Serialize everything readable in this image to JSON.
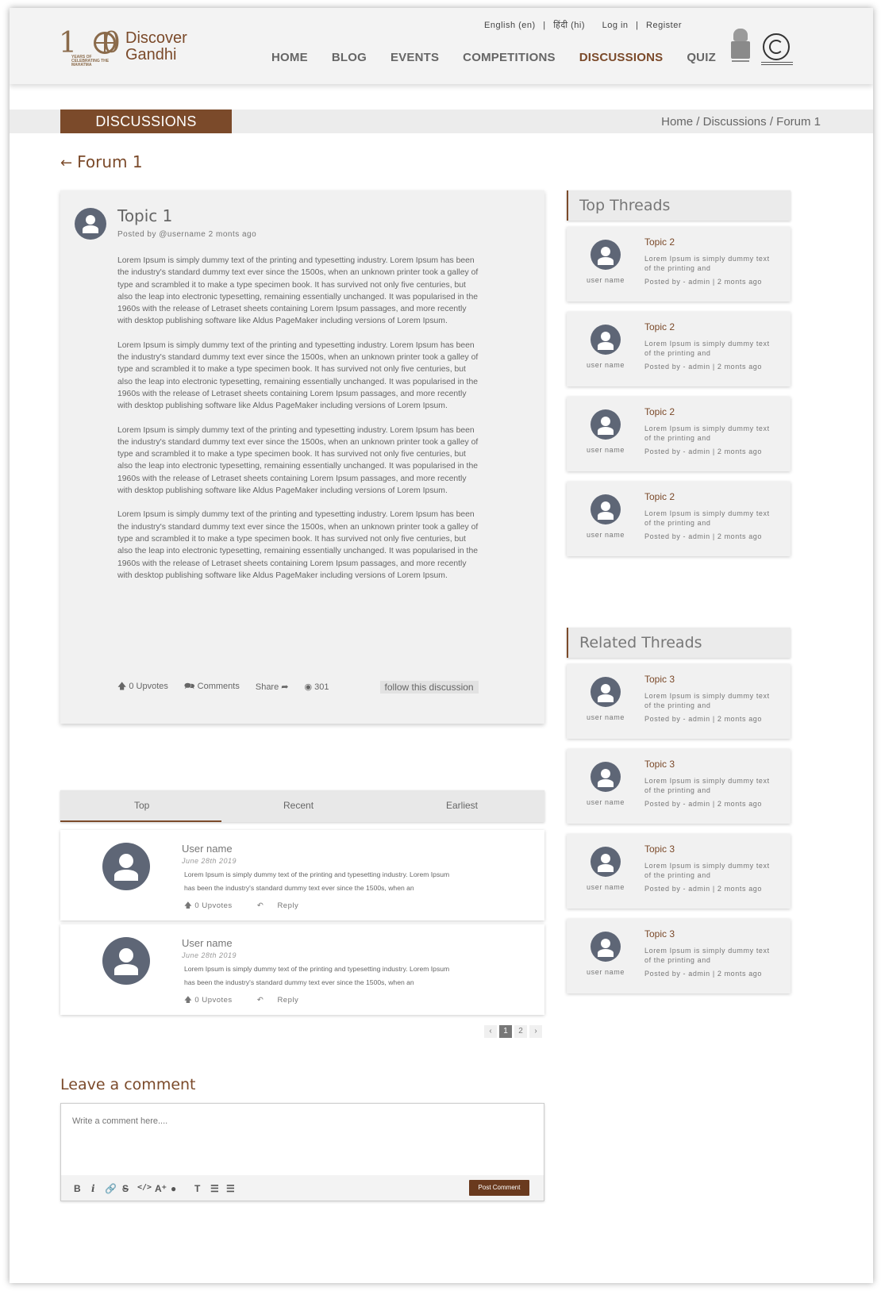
{
  "header": {
    "logo_number": "150",
    "logo_tagline": "YEARS OF CELEBRATING THE MAHATMA",
    "logo_title": "Discover Gandhi",
    "top_links": [
      "English (en)",
      "|",
      "हिंदी (hi)",
      "Log in",
      "|",
      "Register"
    ],
    "nav": [
      "HOME",
      "BLOG",
      "EVENTS",
      "COMPETITIONS",
      "DISCUSSIONS",
      "QUIZ"
    ],
    "active_nav": "DISCUSSIONS"
  },
  "banner": {
    "title": "DISCUSSIONS",
    "breadcrumb": "Home / Discussions / Forum 1"
  },
  "forum": {
    "back_arrow": "←",
    "title": "Forum 1"
  },
  "post": {
    "title": "Topic 1",
    "meta": "Posted by @username  2 monts ago",
    "paragraph": "Lorem Ipsum is simply dummy text of the printing and typesetting industry. Lorem Ipsum has been the industry's standard dummy text ever since the 1500s, when an unknown printer took a galley of type and scrambled it to make a type specimen book. It has survived not only five centuries, but also the leap into electronic typesetting, remaining essentially unchanged. It was popularised in the 1960s with the release of Letraset sheets containing Lorem Ipsum passages, and more recently with desktop publishing software like Aldus PageMaker including versions of Lorem Ipsum.",
    "upvotes": "0 Upvotes",
    "comments": "Comments",
    "share": "Share",
    "views": "301",
    "follow": "follow this discussion"
  },
  "tabs": [
    "Top",
    "Recent",
    "Earliest"
  ],
  "comments": [
    {
      "name": "User name",
      "date": "June 28th 2019",
      "text": "Lorem Ipsum is simply dummy text of the printing and typesetting industry. Lorem Ipsum has been the industry's standard dummy text ever since the 1500s, when an",
      "upvotes": "0 Upvotes",
      "reply": "Reply"
    },
    {
      "name": "User name",
      "date": "June 28th 2019",
      "text": "Lorem Ipsum is simply dummy text of the printing and typesetting industry. Lorem Ipsum has been the industry's standard dummy text ever since the 1500s, when an",
      "upvotes": "0 Upvotes",
      "reply": "Reply"
    }
  ],
  "pagination": {
    "prev": "‹",
    "pages": [
      "1",
      "2"
    ],
    "current": "1",
    "next": "›"
  },
  "leave_comment": {
    "title": "Leave a comment",
    "placeholder": "Write a comment here....",
    "submit": "Post Comment"
  },
  "top_threads": {
    "title": "Top Threads",
    "items": [
      {
        "user": "user name",
        "title": "Topic 2",
        "desc": "Lorem Ipsum is simply dummy text of the printing and",
        "posted": "Posted by - admin | 2 monts ago"
      },
      {
        "user": "user name",
        "title": "Topic 2",
        "desc": "Lorem Ipsum is simply dummy text of the printing and",
        "posted": "Posted by - admin | 2 monts ago"
      },
      {
        "user": "user name",
        "title": "Topic 2",
        "desc": "Lorem Ipsum is simply dummy text of the printing and",
        "posted": "Posted by - admin | 2 monts ago"
      },
      {
        "user": "user name",
        "title": "Topic 2",
        "desc": "Lorem Ipsum is simply dummy text of the printing and",
        "posted": "Posted by - admin | 2 monts ago"
      }
    ]
  },
  "related_threads": {
    "title": "Related Threads",
    "items": [
      {
        "user": "user name",
        "title": "Topic 3",
        "desc": "Lorem Ipsum is simply dummy text of the printing and",
        "posted": "Posted by - admin | 2 monts ago"
      },
      {
        "user": "user name",
        "title": "Topic 3",
        "desc": "Lorem Ipsum is simply dummy text of the printing and",
        "posted": "Posted by - admin | 2 monts ago"
      },
      {
        "user": "user name",
        "title": "Topic 3",
        "desc": "Lorem Ipsum is simply dummy text of the printing and",
        "posted": "Posted by - admin | 2 monts ago"
      },
      {
        "user": "user name",
        "title": "Topic 3",
        "desc": "Lorem Ipsum is simply dummy text of the printing and",
        "posted": "Posted by - admin | 2 monts ago"
      }
    ]
  },
  "colors": {
    "brand": "#7b4a2a",
    "avatar": "#5e6676",
    "panel": "#f1f1f1"
  }
}
